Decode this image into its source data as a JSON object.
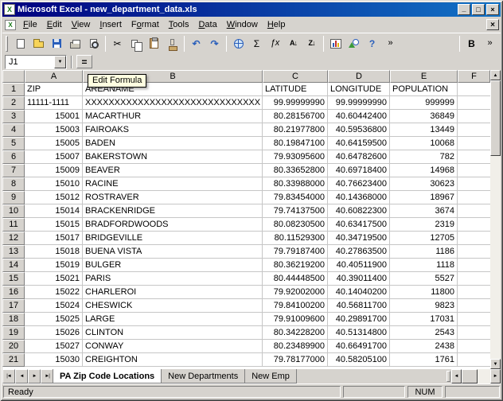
{
  "title_bar": {
    "title": "Microsoft Excel - new_department_data.xls",
    "icon_glyph": "X",
    "buttons": [
      {
        "name": "minimize-button",
        "glyph": "_"
      },
      {
        "name": "maximize-button",
        "glyph": "□"
      },
      {
        "name": "close-button",
        "glyph": "×"
      }
    ]
  },
  "menu_bar": {
    "icon_glyph": "X",
    "close_glyph": "×",
    "items": [
      {
        "label": "File",
        "accel": 0
      },
      {
        "label": "Edit",
        "accel": 0
      },
      {
        "label": "View",
        "accel": 0
      },
      {
        "label": "Insert",
        "accel": 0
      },
      {
        "label": "Format",
        "accel": 1
      },
      {
        "label": "Tools",
        "accel": 0
      },
      {
        "label": "Data",
        "accel": 0
      },
      {
        "label": "Window",
        "accel": 0
      },
      {
        "label": "Help",
        "accel": 0
      }
    ]
  },
  "toolbar": {
    "buttons": [
      {
        "name": "new-document-button",
        "icon": "new-document-icon",
        "css": "page"
      },
      {
        "name": "open-button",
        "icon": "open-folder-icon",
        "css": "folder"
      },
      {
        "name": "save-button",
        "icon": "save-floppy-icon",
        "css": "floppy"
      },
      {
        "name": "print-button",
        "icon": "printer-icon",
        "css": "printer"
      },
      {
        "name": "print-preview-button",
        "icon": "print-preview-icon",
        "css": "preview"
      },
      {
        "type": "separator"
      },
      {
        "name": "cut-button",
        "icon": "scissors-icon",
        "glyph": "✂"
      },
      {
        "name": "copy-button",
        "icon": "copy-icon",
        "css": "copy"
      },
      {
        "name": "paste-button",
        "icon": "paste-clipboard-icon",
        "css": "paste"
      },
      {
        "name": "format-painter-button",
        "icon": "format-painter-icon",
        "css": "painter"
      },
      {
        "type": "separator"
      },
      {
        "name": "undo-button",
        "icon": "undo-arrow-icon",
        "glyph": "↶",
        "cls": "blue"
      },
      {
        "name": "redo-button",
        "icon": "redo-arrow-icon",
        "glyph": "↷",
        "cls": "blue"
      },
      {
        "type": "separator"
      },
      {
        "name": "insert-hyperlink-button",
        "icon": "globe-hyperlink-icon",
        "css": "globe"
      },
      {
        "name": "autosum-button",
        "icon": "sigma-icon",
        "glyph": "Σ"
      },
      {
        "name": "paste-function-button",
        "icon": "function-icon",
        "glyph": "ƒx",
        "cls": "fx"
      },
      {
        "name": "sort-ascending-button",
        "icon": "sort-ascending-icon",
        "glyph": "A↓",
        "cls": "sort"
      },
      {
        "name": "sort-descending-button",
        "icon": "sort-descending-icon",
        "glyph": "Z↓",
        "cls": "sort"
      },
      {
        "type": "separator"
      },
      {
        "name": "chart-wizard-button",
        "icon": "chart-wizard-icon",
        "css": "chart"
      },
      {
        "name": "drawing-button",
        "icon": "drawing-icon",
        "css": "drawing"
      },
      {
        "name": "help-button",
        "icon": "help-question-icon",
        "glyph": "?",
        "cls": "help"
      },
      {
        "name": "more-buttons-button",
        "icon": "chevron-right-icon",
        "glyph": "»",
        "cls": "chev"
      },
      {
        "type": "spacer"
      },
      {
        "type": "separator"
      },
      {
        "name": "bold-button",
        "icon": "bold-icon",
        "glyph": "B",
        "cls": "bold"
      },
      {
        "name": "formatting-more-buttons-button",
        "icon": "chevron-right-icon",
        "glyph": "»",
        "cls": "chev"
      }
    ]
  },
  "formula_bar": {
    "name_box_value": "J1",
    "dropdown_glyph": "▼",
    "equals_label": "=",
    "tooltip": "Edit Formula"
  },
  "scrollbars": {
    "up": "▲",
    "down": "▼",
    "left": "◄",
    "right": "►"
  },
  "grid": {
    "columns": [
      "A",
      "B",
      "C",
      "D",
      "E",
      "F"
    ],
    "rows": [
      [
        "ZIP",
        "AREANAME",
        "LATITUDE",
        "LONGITUDE",
        "POPULATION"
      ],
      [
        "11111-1111",
        "XXXXXXXXXXXXXXXXXXXXXXXXXXXXXX",
        "99.99999990",
        "99.99999990",
        "999999"
      ],
      [
        "15001",
        "MACARTHUR",
        "80.28156700",
        "40.60442400",
        "36849"
      ],
      [
        "15003",
        "FAIROAKS",
        "80.21977800",
        "40.59536800",
        "13449"
      ],
      [
        "15005",
        "BADEN",
        "80.19847100",
        "40.64159500",
        "10068"
      ],
      [
        "15007",
        "BAKERSTOWN",
        "79.93095600",
        "40.64782600",
        "782"
      ],
      [
        "15009",
        "BEAVER",
        "80.33652800",
        "40.69718400",
        "14968"
      ],
      [
        "15010",
        "RACINE",
        "80.33988000",
        "40.76623400",
        "30623"
      ],
      [
        "15012",
        "ROSTRAVER",
        "79.83454000",
        "40.14368000",
        "18967"
      ],
      [
        "15014",
        "BRACKENRIDGE",
        "79.74137500",
        "40.60822300",
        "3674"
      ],
      [
        "15015",
        "BRADFORDWOODS",
        "80.08230500",
        "40.63417500",
        "2319"
      ],
      [
        "15017",
        "BRIDGEVILLE",
        "80.11529300",
        "40.34719500",
        "12705"
      ],
      [
        "15018",
        "BUENA VISTA",
        "79.79187400",
        "40.27863500",
        "1186"
      ],
      [
        "15019",
        "BULGER",
        "80.36219200",
        "40.40511900",
        "1118"
      ],
      [
        "15021",
        "PARIS",
        "80.44448500",
        "40.39011400",
        "5527"
      ],
      [
        "15022",
        "CHARLEROI",
        "79.92002000",
        "40.14040200",
        "11800"
      ],
      [
        "15024",
        "CHESWICK",
        "79.84100200",
        "40.56811700",
        "9823"
      ],
      [
        "15025",
        "LARGE",
        "79.91009600",
        "40.29891700",
        "17031"
      ],
      [
        "15026",
        "CLINTON",
        "80.34228200",
        "40.51314800",
        "2543"
      ],
      [
        "15027",
        "CONWAY",
        "80.23489900",
        "40.66491700",
        "2438"
      ],
      [
        "15030",
        "CREIGHTON",
        "79.78177000",
        "40.58205100",
        "1761"
      ]
    ]
  },
  "sheet_tabs": {
    "nav": [
      {
        "name": "first",
        "glyph": "|◄"
      },
      {
        "name": "previous",
        "glyph": "◄"
      },
      {
        "name": "next",
        "glyph": "►"
      },
      {
        "name": "last",
        "glyph": "►|"
      }
    ],
    "tabs": [
      {
        "label": "PA Zip Code Locations",
        "active": true
      },
      {
        "label": "New Departments",
        "active": false
      },
      {
        "label": "New Emp",
        "active": false
      }
    ]
  },
  "status_bar": {
    "ready": "Ready",
    "num": "NUM"
  },
  "colors": {
    "title_gradient_start": "#00007f",
    "title_gradient_end": "#1273c6",
    "chrome": "#d6d3ce",
    "tooltip_bg": "#ffffe1",
    "grid_line": "#c6c6c6"
  }
}
